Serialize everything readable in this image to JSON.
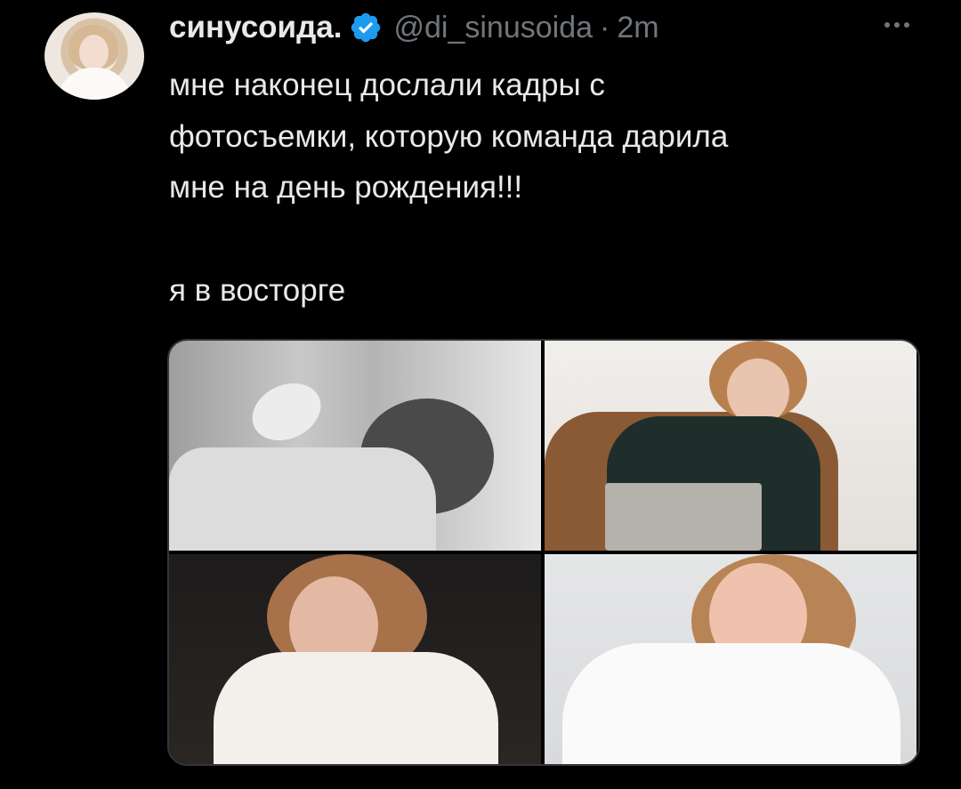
{
  "tweet": {
    "author_name": "синусоида.",
    "handle": "@di_sinusoida",
    "separator": "·",
    "time": "2m",
    "text_lines": [
      "мне наконец дослали кадры с",
      "фотосъемки, которую команда дарила",
      "мне на день рождения!!!"
    ],
    "text_after_break": "я в восторге"
  },
  "icons": {
    "verified": "verified-badge-icon",
    "more": "more-options-icon"
  },
  "colors": {
    "background": "#000000",
    "text": "#e7e9ea",
    "secondary_text": "#71767b",
    "verified_blue": "#1d9bf0"
  },
  "media": {
    "photo_count": 4
  }
}
